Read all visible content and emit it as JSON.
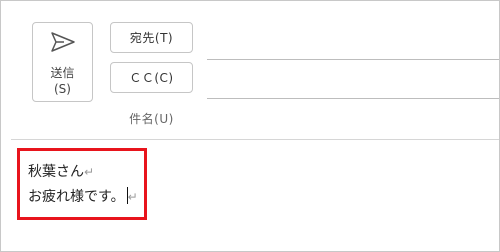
{
  "toolbar": {
    "send_label": "送信",
    "send_shortcut": "(S)",
    "send_icon": "paper-plane-icon",
    "to_label": "宛先(T)",
    "cc_label": "ＣＣ(C)",
    "subject_label": "件名(U)"
  },
  "body": {
    "lines": [
      "秋葉さん",
      "お疲れ様です。"
    ],
    "paragraph_mark": "↵"
  },
  "colors": {
    "highlight": "#e8141c",
    "border": "#c6c6c6"
  }
}
